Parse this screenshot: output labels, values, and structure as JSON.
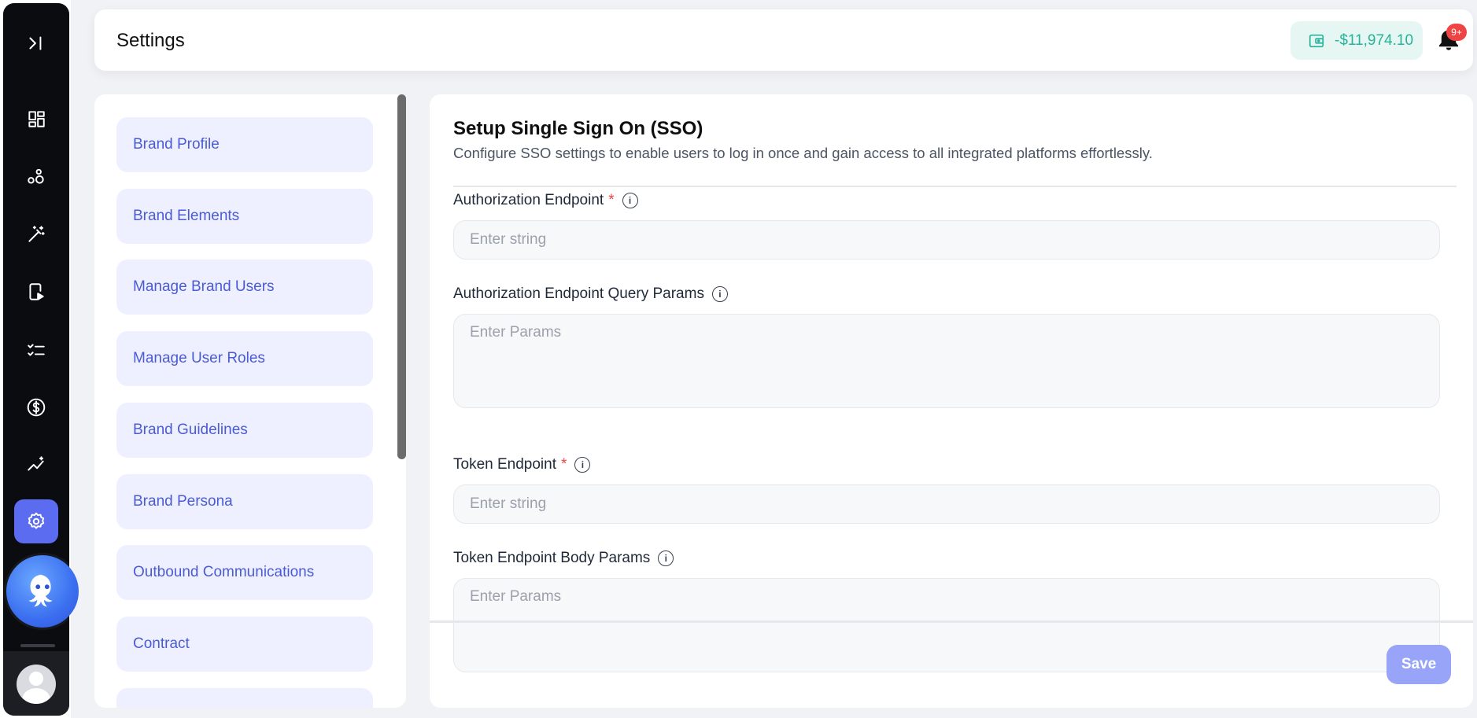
{
  "header": {
    "title": "Settings",
    "balance": "-$11,974.10",
    "notification_badge": "9+"
  },
  "nav_rail": {
    "icons": [
      "expand-sidebar-icon",
      "dashboard-icon",
      "nodes-icon",
      "magic-wand-icon",
      "mobile-play-icon",
      "checklist-icon",
      "dollar-icon",
      "analytics-icon",
      "settings-icon",
      "octopus-assistant-icon",
      "user-avatar"
    ],
    "active": "settings-icon"
  },
  "settings_menu": {
    "items": [
      {
        "label": "Brand Profile"
      },
      {
        "label": "Brand Elements"
      },
      {
        "label": "Manage Brand Users"
      },
      {
        "label": "Manage User Roles"
      },
      {
        "label": "Brand Guidelines"
      },
      {
        "label": "Brand Persona"
      },
      {
        "label": "Outbound Communications"
      },
      {
        "label": "Contract"
      }
    ]
  },
  "sso": {
    "title": "Setup Single Sign On (SSO)",
    "description": "Configure SSO settings to enable users to log in once and gain access to all integrated platforms effortlessly.",
    "fields": [
      {
        "label": "Authorization Endpoint",
        "required": "*",
        "placeholder": "Enter string",
        "value": ""
      },
      {
        "label": "Authorization Endpoint Query Params",
        "placeholder": "Enter Params",
        "value": ""
      },
      {
        "label": "Token Endpoint",
        "required": "*",
        "placeholder": "Enter string",
        "value": ""
      },
      {
        "label": "Token Endpoint Body Params",
        "placeholder": "Enter Params",
        "value": ""
      }
    ],
    "save_label": "Save"
  },
  "colors": {
    "accent": "#5b6cf0",
    "menu_item_bg": "#eef0ff",
    "menu_item_text": "#4a5bd4",
    "balance_text": "#26b39a",
    "badge": "#ef4444",
    "save_button": "#97a4f7"
  }
}
